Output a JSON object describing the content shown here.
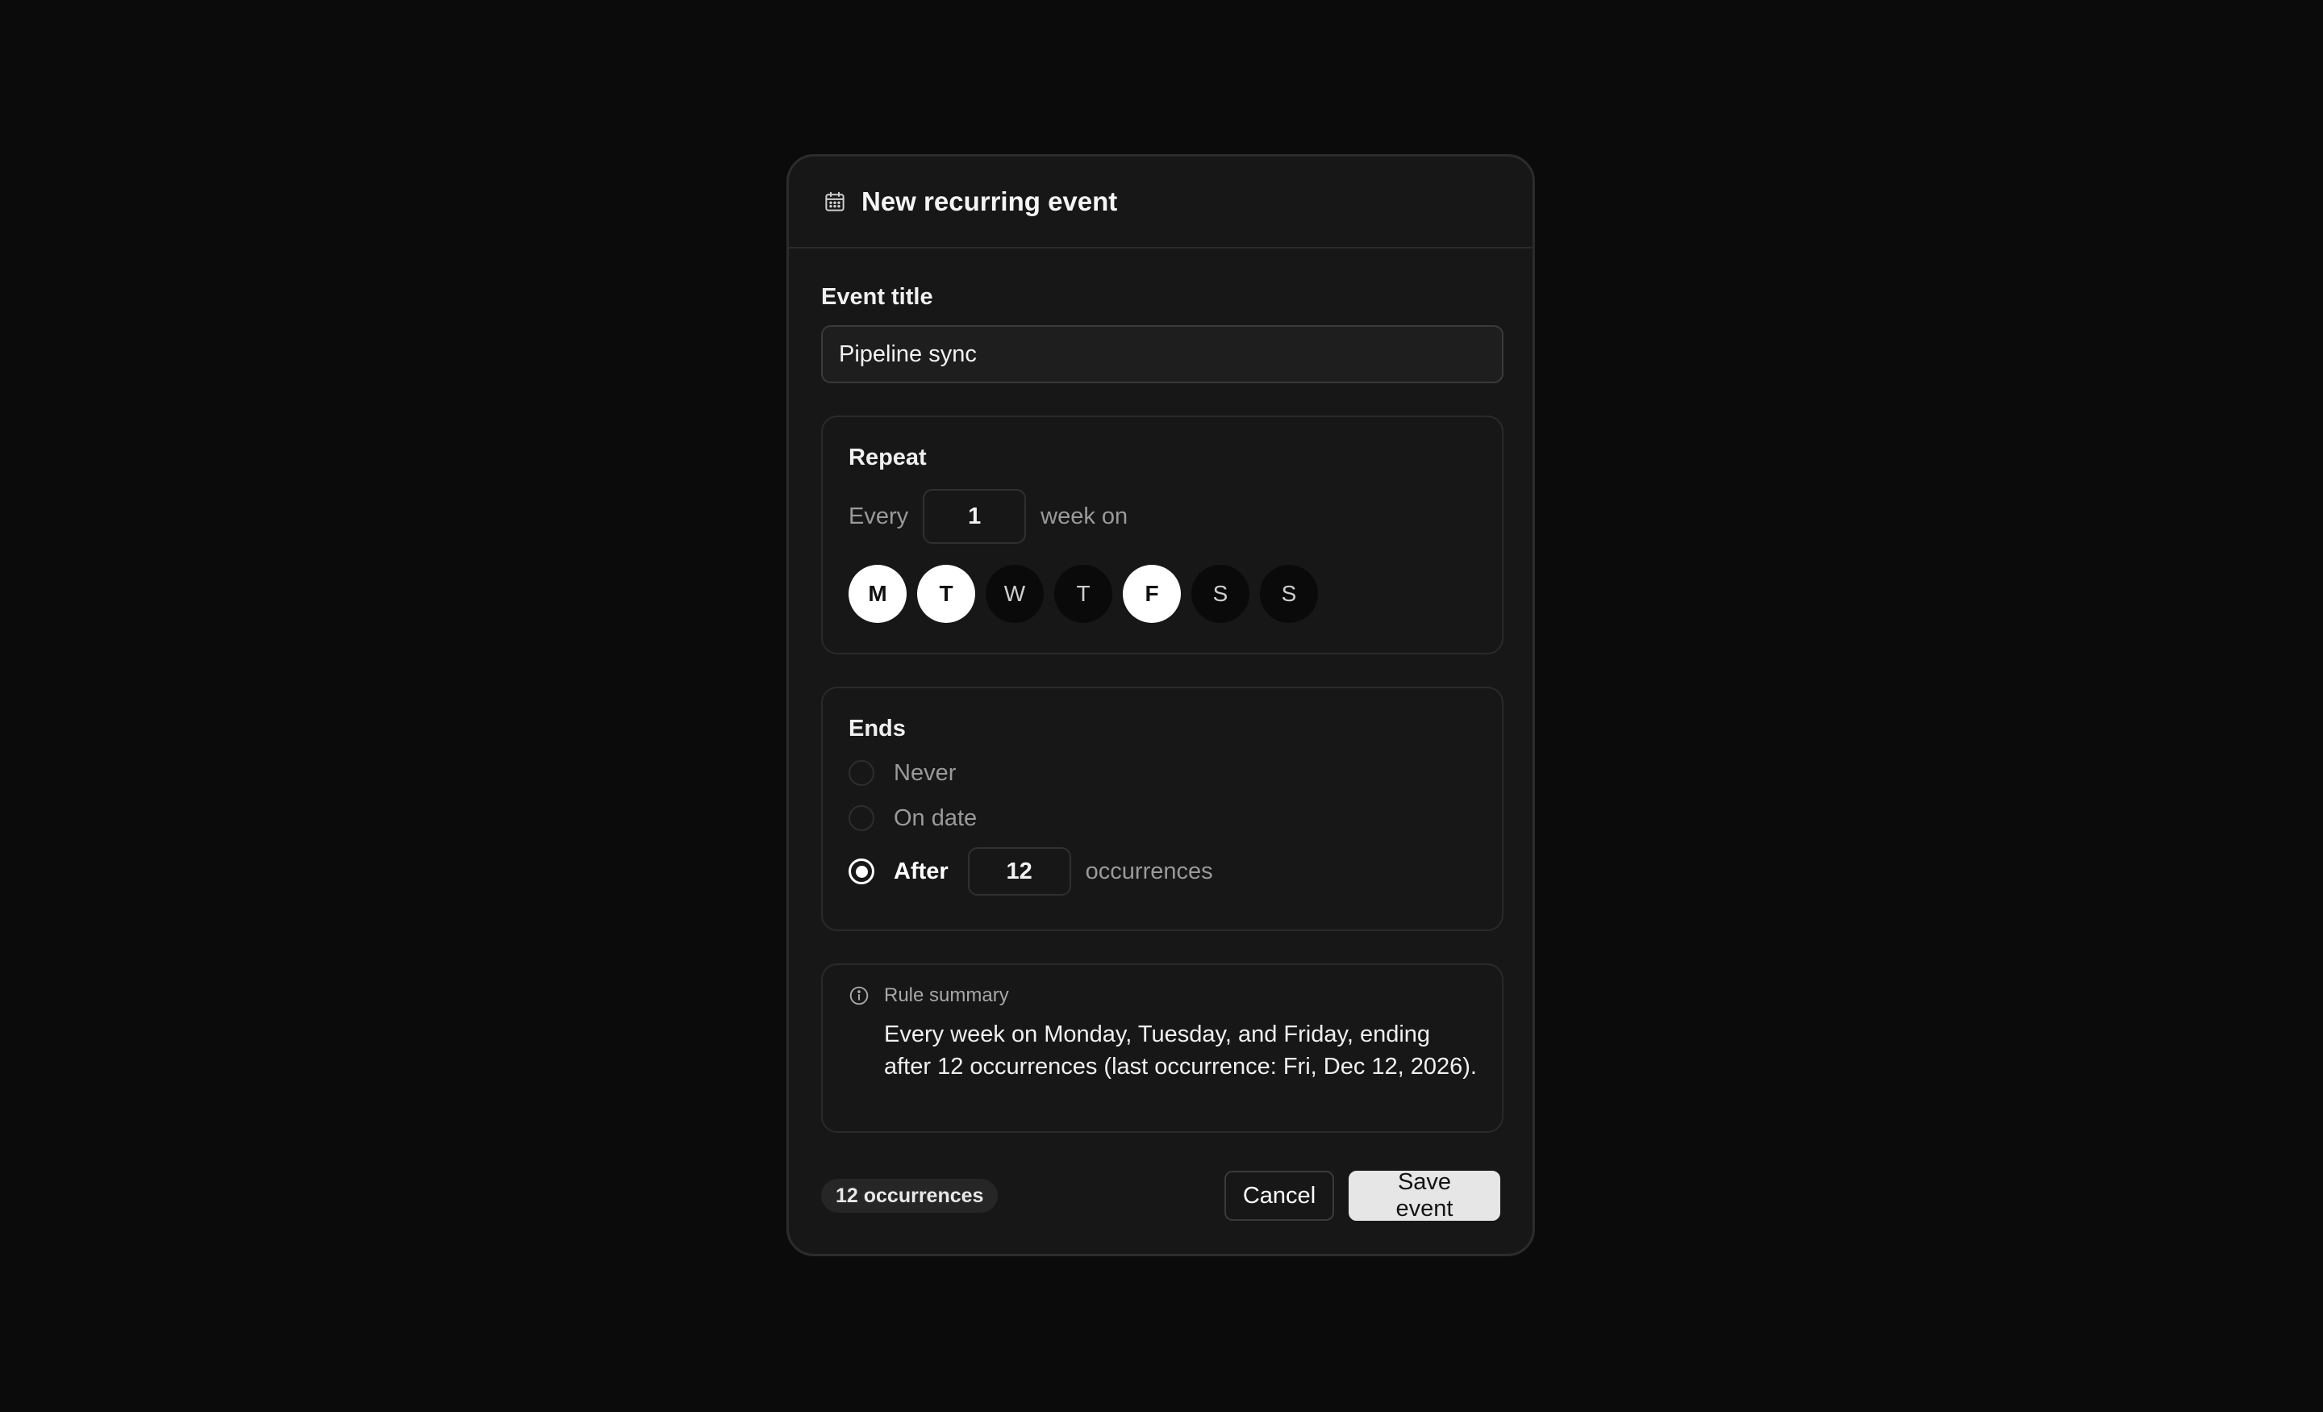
{
  "dialog": {
    "title": "New recurring event",
    "icon": "calendar-icon"
  },
  "event_title": {
    "label": "Event title",
    "value": "Pipeline sync"
  },
  "repeat": {
    "label": "Repeat",
    "every_text": "Every",
    "interval": "1",
    "unit_text": "week on",
    "days": [
      {
        "letter": "M",
        "selected": true
      },
      {
        "letter": "T",
        "selected": true
      },
      {
        "letter": "W",
        "selected": false
      },
      {
        "letter": "T",
        "selected": false
      },
      {
        "letter": "F",
        "selected": true
      },
      {
        "letter": "S",
        "selected": false
      },
      {
        "letter": "S",
        "selected": false
      }
    ]
  },
  "ends": {
    "label": "Ends",
    "options": [
      "Never",
      "On date",
      "After"
    ],
    "selected": "After",
    "occurrences": "12",
    "occurrences_text": "occurrences"
  },
  "summary": {
    "icon": "info-icon",
    "label": "Rule summary",
    "text": "Every week on Monday, Tuesday, and Friday, ending after 12 occurrences (last occurrence: Fri, Dec 12, 2026)."
  },
  "footer": {
    "badge": "12 occurrences",
    "cancel_label": "Cancel",
    "save_label": "Save event"
  },
  "colors": {
    "background": "#0b0b0b",
    "panel": "#171717",
    "selected_day": "#ffffff",
    "save_button": "#e6e6e6"
  }
}
